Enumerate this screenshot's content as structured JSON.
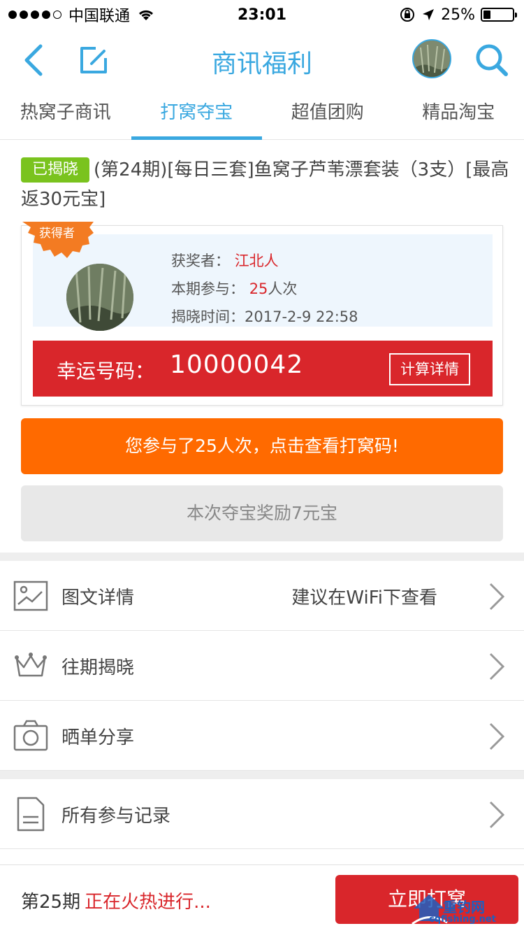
{
  "status_bar": {
    "carrier": "中国联通",
    "time": "23:01",
    "battery_text": "25%",
    "battery_level": 0.25
  },
  "nav": {
    "title": "商讯福利",
    "icons": [
      "back-icon",
      "edit-icon",
      "avatar",
      "search-icon"
    ]
  },
  "tabs": [
    {
      "label": "热窝子商讯",
      "active": false
    },
    {
      "label": "打窝夺宝",
      "active": true
    },
    {
      "label": "超值团购",
      "active": false
    },
    {
      "label": "精品淘宝",
      "active": false
    }
  ],
  "product": {
    "tag": "已揭晓",
    "title": "(第24期)[每日三套]鱼窝子芦苇漂套装（3支）[最高返30元宝]"
  },
  "winner": {
    "ribbon": "获得者",
    "winner_label": "获奖者：",
    "winner_name": "江北人",
    "participate_label": "本期参与：",
    "participate_count": "25",
    "participate_unit": "人次",
    "reveal_label": "揭晓时间：",
    "reveal_time": "2017-2-9 22:58",
    "lucky_label": "幸运号码：",
    "lucky_number": "10000042",
    "calc_button": "计算详情"
  },
  "actions": {
    "participated": "您参与了25人次，点击查看打窝码!",
    "reward": "本次夺宝奖励7元宝"
  },
  "list": [
    {
      "label": "图文详情",
      "extra": "建议在WiFi下查看",
      "icon": "image-icon"
    },
    {
      "label": "往期揭晓",
      "extra": "",
      "icon": "crown-icon"
    },
    {
      "label": "晒单分享",
      "extra": "",
      "icon": "camera-icon"
    },
    {
      "label": "所有参与记录",
      "extra": "",
      "icon": "document-icon"
    }
  ],
  "bottom": {
    "period": "第25期",
    "status": "正在火热进行...",
    "buy_button": "立即打窝",
    "watermark_text": "重钓网",
    "watermark_url": "cqfishing.net"
  },
  "colors": {
    "accent": "#3aa8e0",
    "red": "#d9262b",
    "orange": "#ff6a00",
    "green_tag": "#7ac31e"
  }
}
